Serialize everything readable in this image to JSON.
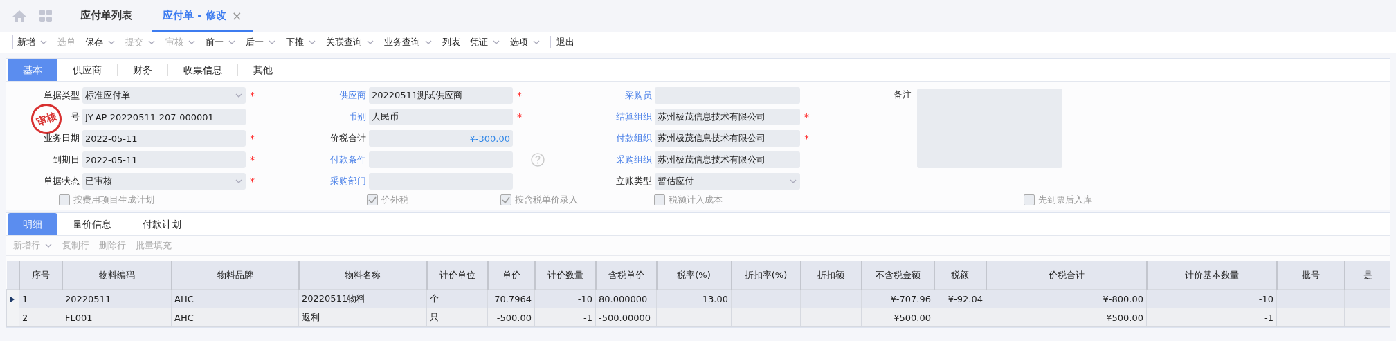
{
  "nav_tabs": [
    {
      "label": "应付单列表",
      "selected": false
    },
    {
      "label": "应付单 - 修改",
      "selected": true,
      "close": "×"
    }
  ],
  "toolbar": [
    {
      "label": "新增",
      "disabled": false,
      "dropdown": true
    },
    {
      "label": "选单",
      "disabled": true,
      "dropdown": false
    },
    {
      "label": "保存",
      "disabled": false,
      "dropdown": true
    },
    {
      "label": "提交",
      "disabled": true,
      "dropdown": true
    },
    {
      "label": "审核",
      "disabled": true,
      "dropdown": true
    },
    {
      "label": "前一",
      "disabled": false,
      "dropdown": true
    },
    {
      "label": "后一",
      "disabled": false,
      "dropdown": true
    },
    {
      "label": "下推",
      "disabled": false,
      "dropdown": true
    },
    {
      "label": "关联查询",
      "disabled": false,
      "dropdown": true
    },
    {
      "label": "业务查询",
      "disabled": false,
      "dropdown": true
    },
    {
      "label": "列表",
      "disabled": false,
      "dropdown": false
    },
    {
      "label": "凭证",
      "disabled": false,
      "dropdown": true
    },
    {
      "label": "选项",
      "disabled": false,
      "dropdown": true
    },
    {
      "label": "退出",
      "disabled": false,
      "dropdown": false,
      "separated": true
    }
  ],
  "form_tabs": [
    {
      "label": "基本",
      "selected": true
    },
    {
      "label": "供应商",
      "selected": false
    },
    {
      "label": "财务",
      "selected": false
    },
    {
      "label": "收票信息",
      "selected": false
    },
    {
      "label": "其他",
      "selected": false
    }
  ],
  "stamp": "审核",
  "form_columns": [
    [
      {
        "label": "单据类型",
        "link": false,
        "kind": "select",
        "value": "标准应付单",
        "required_mark": "*"
      },
      {
        "label": "号",
        "link": false,
        "kind": "text",
        "value": "JY-AP-20220511-207-000001"
      },
      {
        "label": "业务日期",
        "link": false,
        "kind": "text",
        "value": "2022-05-11",
        "required_mark": "*"
      },
      {
        "label": "到期日",
        "link": false,
        "kind": "text",
        "value": "2022-05-11",
        "required_mark": "*"
      },
      {
        "label": "单据状态",
        "link": false,
        "kind": "select",
        "value": "已审核",
        "required_mark": "*"
      }
    ],
    [
      {
        "label": "供应商",
        "link": true,
        "kind": "text",
        "value": "20220511测试供应商",
        "required_mark": "*"
      },
      {
        "label": "币别",
        "link": true,
        "kind": "text",
        "value": "人民币",
        "required_mark": "*"
      },
      {
        "label": "价税合计",
        "link": false,
        "kind": "amount",
        "value": "¥-300.00"
      },
      {
        "label": "付款条件",
        "link": true,
        "kind": "text",
        "help": true
      },
      {
        "label": "采购部门",
        "link": true,
        "kind": "text"
      }
    ],
    [
      {
        "label": "采购员",
        "link": true,
        "kind": "text"
      },
      {
        "label": "结算组织",
        "link": true,
        "kind": "text",
        "value": "苏州极茂信息技术有限公司",
        "required_mark": "*"
      },
      {
        "label": "付款组织",
        "link": true,
        "kind": "text",
        "value": "苏州极茂信息技术有限公司",
        "required_mark": "*"
      },
      {
        "label": "采购组织",
        "link": true,
        "kind": "text",
        "value": "苏州极茂信息技术有限公司"
      },
      {
        "label": "立账类型",
        "link": false,
        "kind": "select",
        "value": "暂估应付"
      }
    ]
  ],
  "remark": {
    "label": "备注"
  },
  "options": [
    {
      "label": "按费用项目生成计划",
      "checked": false
    },
    {
      "label": "价外税",
      "checked": true
    },
    {
      "label": "按含税单价录入",
      "checked": true
    },
    {
      "label": "税额计入成本",
      "checked": false
    },
    {
      "label": "先到票后入库",
      "checked": false
    }
  ],
  "detail_tabs": [
    {
      "label": "明细",
      "selected": true
    },
    {
      "label": "量价信息",
      "selected": false
    },
    {
      "label": "付款计划",
      "selected": false
    }
  ],
  "detail_toolbar": [
    {
      "label": "新增行",
      "dropdown": true
    },
    {
      "label": "复制行",
      "dropdown": false
    },
    {
      "label": "删除行",
      "dropdown": false
    },
    {
      "label": "批量填充",
      "dropdown": false
    }
  ],
  "table": {
    "columns": [
      "序号",
      "物料编码",
      "物料品牌",
      "物料名称",
      "计价单位",
      "单价",
      "计价数量",
      "含税单价",
      "税率(%)",
      "折扣率(%)",
      "折扣额",
      "不含税金额",
      "税额",
      "价税合计",
      "计价基本数量",
      "批号",
      "是"
    ],
    "rows": [
      {
        "selected": true,
        "cells": [
          "1",
          "20220511",
          "AHC",
          "20220511物料",
          "个",
          "70.7964",
          "-10",
          "80.000000",
          "13.00",
          "",
          "",
          "¥-707.96",
          "¥-92.04",
          "¥-800.00",
          "-10",
          "",
          ""
        ]
      },
      {
        "selected": false,
        "cells": [
          "2",
          "FL001",
          "AHC",
          "返利",
          "只",
          "-500.00",
          "-1",
          "-500.00000",
          "",
          "",
          "",
          "¥500.00",
          "",
          "¥500.00",
          "-1",
          "",
          ""
        ]
      }
    ]
  }
}
